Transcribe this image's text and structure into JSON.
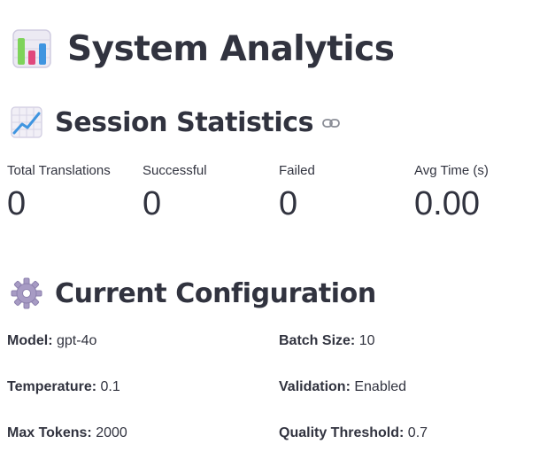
{
  "page": {
    "title": "System Analytics",
    "title_icon": "bar-chart-icon"
  },
  "session": {
    "heading": "Session Statistics",
    "heading_icon": "chart-increasing-icon",
    "anchor_icon": "link-icon",
    "metrics": [
      {
        "label": "Total Translations",
        "value": "0"
      },
      {
        "label": "Successful",
        "value": "0"
      },
      {
        "label": "Failed",
        "value": "0"
      },
      {
        "label": "Avg Time (s)",
        "value": "0.00"
      }
    ]
  },
  "config": {
    "heading": "Current Configuration",
    "heading_icon": "gear-icon",
    "items": [
      {
        "label": "Model:",
        "value": "gpt-4o"
      },
      {
        "label": "Batch Size:",
        "value": "10"
      },
      {
        "label": "Temperature:",
        "value": "0.1"
      },
      {
        "label": "Validation:",
        "value": "Enabled"
      },
      {
        "label": "Max Tokens:",
        "value": "2000"
      },
      {
        "label": "Quality Threshold:",
        "value": "0.7"
      }
    ]
  },
  "colors": {
    "text": "#31333f",
    "link_icon": "#8a8d96"
  }
}
